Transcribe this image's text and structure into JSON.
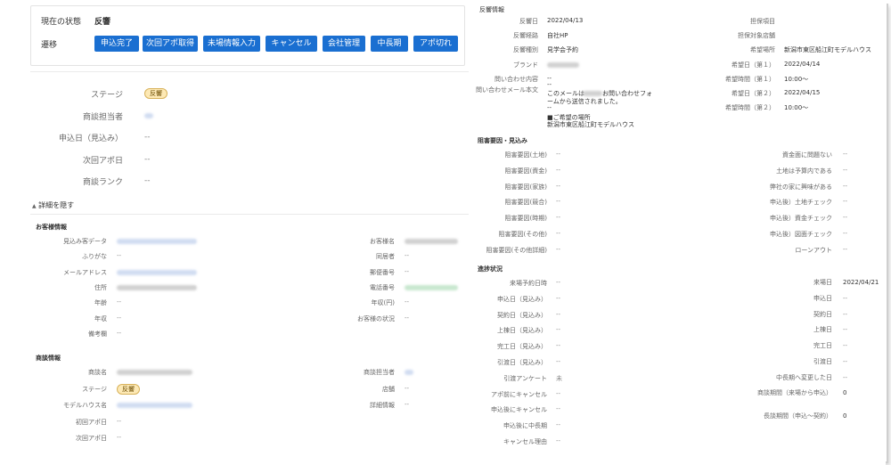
{
  "status": {
    "label": "現在の状態",
    "value": "反響"
  },
  "transition": {
    "label": "遷移",
    "buttons": [
      "申込完了",
      "次回アポ取得",
      "未場情報入力",
      "キャンセル",
      "会社管理",
      "中長期",
      "アポ切れ"
    ]
  },
  "summary": {
    "rows": [
      {
        "label": "ステージ",
        "value": "反響",
        "kind": "badge"
      },
      {
        "label": "商談担当者",
        "value": "",
        "kind": "blur"
      },
      {
        "label": "申込日（見込み）",
        "value": "--",
        "kind": "text"
      },
      {
        "label": "次回アポ日",
        "value": "--",
        "kind": "text"
      },
      {
        "label": "商談ランク",
        "value": "--",
        "kind": "text"
      }
    ]
  },
  "detail_toggle": "詳細を隠す",
  "customer": {
    "title": "お客様情報",
    "left": [
      {
        "label": "見込み客データ",
        "value": "",
        "kind": "blur"
      },
      {
        "label": "ふりがな",
        "value": "--"
      },
      {
        "label": "メールアドレス",
        "value": "",
        "kind": "blur"
      },
      {
        "label": "住所",
        "value": "",
        "kind": "blurg"
      },
      {
        "label": "年齢",
        "value": "--"
      },
      {
        "label": "年収",
        "value": "--"
      },
      {
        "label": "備考欄",
        "value": "--"
      }
    ],
    "right": [
      {
        "label": "お客様名",
        "value": "",
        "kind": "blurg"
      },
      {
        "label": "同居者",
        "value": "--"
      },
      {
        "label": "郵便番号",
        "value": "--"
      },
      {
        "label": "電話番号",
        "value": "",
        "kind": "blurgr"
      },
      {
        "label": "年収(円)",
        "value": "--"
      },
      {
        "label": "お客様の状況",
        "value": "--"
      }
    ]
  },
  "deal": {
    "title": "商談情報",
    "left": [
      {
        "label": "商談名",
        "value": "",
        "kind": "blurg"
      },
      {
        "label": "ステージ",
        "value": "反響",
        "kind": "badge"
      },
      {
        "label": "モデルハウス名",
        "value": "",
        "kind": "blur"
      },
      {
        "label": "初回アポ日",
        "value": "--"
      },
      {
        "label": "次回アポ日",
        "value": "--"
      }
    ],
    "right": [
      {
        "label": "商談担当者",
        "value": "",
        "kind": "blur"
      },
      {
        "label": "店舗",
        "value": "--"
      },
      {
        "label": "詳細情報",
        "value": "--"
      }
    ]
  },
  "inquiry": {
    "title": "反響情報",
    "left": [
      {
        "label": "反響日",
        "value": "2022/04/13"
      },
      {
        "label": "反響経路",
        "value": "自社HP"
      },
      {
        "label": "反響種別",
        "value": "見学会予約"
      },
      {
        "label": "ブランド",
        "value": "",
        "kind": "blurg"
      },
      {
        "label": "問い合わせ内容",
        "value": "--"
      }
    ],
    "right": [
      {
        "label": "担保項目",
        "value": ""
      },
      {
        "label": "担保対象店舗",
        "value": ""
      },
      {
        "label": "希望場所",
        "value": "新潟市東区船江町モデルハウス"
      },
      {
        "label": "希望日（第１）",
        "value": "2022/04/14"
      },
      {
        "label": "希望時間（第１）",
        "value": "10:00〜"
      },
      {
        "label": "希望日（第２）",
        "value": "2022/04/15"
      },
      {
        "label": "希望時間（第２）",
        "value": "10:00〜"
      }
    ],
    "mail_label": "問い合わせメール本文",
    "mail_lines": [
      "--",
      "このメールは",
      "お問い合わせフォ",
      "ームから送信されました。",
      "--",
      "■ご希望の場所",
      "新潟市東区船江町モデルハウス"
    ]
  },
  "obstacles": {
    "title": "阻害要因・見込み",
    "left": [
      "阻害要因(土地)",
      "阻害要因(資金)",
      "阻害要因(家族)",
      "阻害要因(競合)",
      "阻害要因(時期)",
      "阻害要因(その他)",
      "阻害要因(その他詳細)"
    ],
    "right": [
      "資金面に問題ない",
      "土地は予算内である",
      "弊社の家に興味がある",
      "申込後）土地チェック",
      "申込後）資金チェック",
      "申込後）図面チェック",
      "ローンアウト"
    ],
    "dash": "--"
  },
  "progress": {
    "title": "進捗状況",
    "left": [
      {
        "label": "来場予約日時",
        "value": "--"
      },
      {
        "label": "申込日（見込み）",
        "value": "--"
      },
      {
        "label": "契約日（見込み）",
        "value": "--"
      },
      {
        "label": "上棟日（見込み）",
        "value": "--"
      },
      {
        "label": "完工日（見込み）",
        "value": "--"
      },
      {
        "label": "引渡日（見込み）",
        "value": "--"
      },
      {
        "label": "引渡アンケート",
        "value": "未"
      },
      {
        "label": "アポ前にキャンセル",
        "value": "--"
      },
      {
        "label": "申込後にキャンセル",
        "value": "--"
      },
      {
        "label": "申込後に中長期",
        "value": "--"
      },
      {
        "label": "キャンセル理由",
        "value": "--"
      }
    ],
    "right": [
      {
        "label": "来場日",
        "value": "2022/04/21"
      },
      {
        "label": "申込日",
        "value": "--"
      },
      {
        "label": "契約日",
        "value": "--"
      },
      {
        "label": "上棟日",
        "value": "--"
      },
      {
        "label": "完工日",
        "value": "--"
      },
      {
        "label": "引渡日",
        "value": "--"
      },
      {
        "label": "中長期へ変更した日",
        "value": "--"
      },
      {
        "label": "商談期間（来場から申込）",
        "value": "0"
      },
      {
        "label": "長談期間（申込〜契約）",
        "value": "0"
      }
    ]
  }
}
